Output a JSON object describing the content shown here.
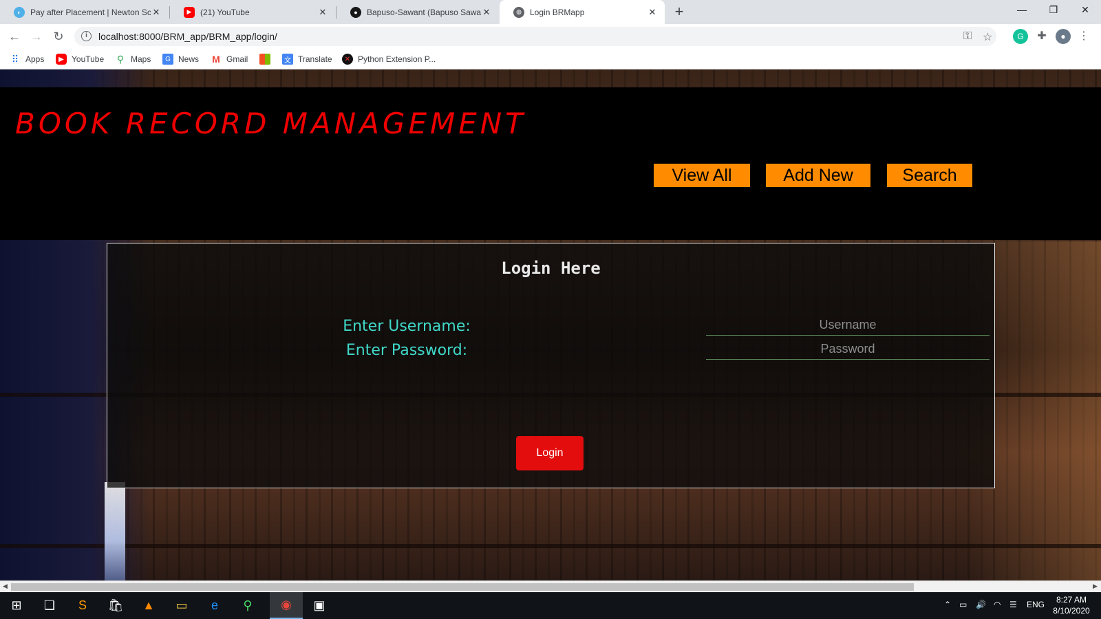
{
  "browser": {
    "tabs": [
      {
        "title": "Pay after Placement | Newton Sc",
        "icon": "newton-icon",
        "color": "#4fb0e8"
      },
      {
        "title": "(21) YouTube",
        "icon": "youtube-icon",
        "color": "#ff0000"
      },
      {
        "title": "Bapuso-Sawant (Bapuso Sawant)",
        "icon": "github-icon",
        "color": "#181717"
      },
      {
        "title": "Login BRMapp",
        "icon": "globe-icon",
        "color": "#5f6368"
      }
    ],
    "address": "localhost:8000/BRM_app/BRM_app/login/",
    "bookmarks": [
      {
        "label": "Apps",
        "icon": "apps-grid-icon"
      },
      {
        "label": "YouTube",
        "icon": "youtube-icon"
      },
      {
        "label": "Maps",
        "icon": "maps-icon"
      },
      {
        "label": "News",
        "icon": "news-icon"
      },
      {
        "label": "Gmail",
        "icon": "gmail-icon"
      },
      {
        "label": "",
        "icon": "microsoft-icon"
      },
      {
        "label": "Translate",
        "icon": "translate-icon"
      },
      {
        "label": "Python Extension P...",
        "icon": "python-extension-icon"
      }
    ]
  },
  "page": {
    "site_title": "BOOK RECORD MANAGEMENT",
    "nav": {
      "view_all": "View All",
      "add_new": "Add New",
      "search": "Search"
    },
    "login": {
      "heading": "Login Here",
      "username_label": "Enter Username:",
      "password_label": "Enter Password:",
      "username_placeholder": "Username",
      "password_placeholder": "Password",
      "submit": "Login"
    },
    "colors": {
      "title": "#ee0000",
      "nav_button": "#ff8c00",
      "label": "#40d8c8",
      "login_button": "#e30d0d"
    }
  },
  "taskbar": {
    "language": "ENG",
    "time": "8:27 AM",
    "date": "8/10/2020"
  }
}
